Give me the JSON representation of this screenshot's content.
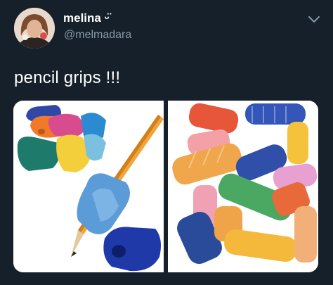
{
  "user": {
    "display_name": "melina ᵕ̈",
    "handle": "@melmadara"
  },
  "icons": {
    "menu": "chevron-down-icon"
  },
  "tweet": {
    "text": "pencil grips !!!"
  },
  "media": {
    "images": [
      "pencil-grips-photo-1",
      "pencil-grips-photo-2"
    ]
  },
  "colors": {
    "background": "#15202b",
    "secondary_text": "#8899a6",
    "primary_text": "#ffffff"
  }
}
